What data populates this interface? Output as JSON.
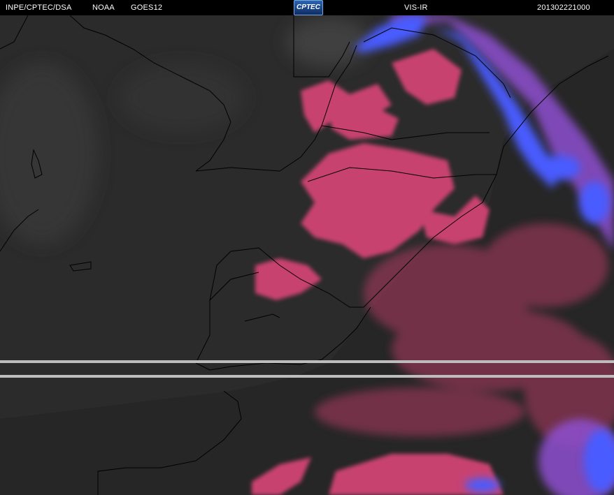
{
  "header": {
    "agency": "INPE/CPTEC/DSA",
    "satellite_provider": "NOAA",
    "satellite": "GOES12",
    "logo_text": "CPTEC",
    "product": "VIS-IR",
    "timestamp": "201302221000"
  },
  "colors": {
    "background": "#2b2b2b",
    "header": "#000000",
    "low_cloud": "#c8436f",
    "high_cloud": "#4a5cff",
    "mid_cloud": "#8e4fd0",
    "coastline": "#000000",
    "scanline": "#bdbdbd"
  }
}
